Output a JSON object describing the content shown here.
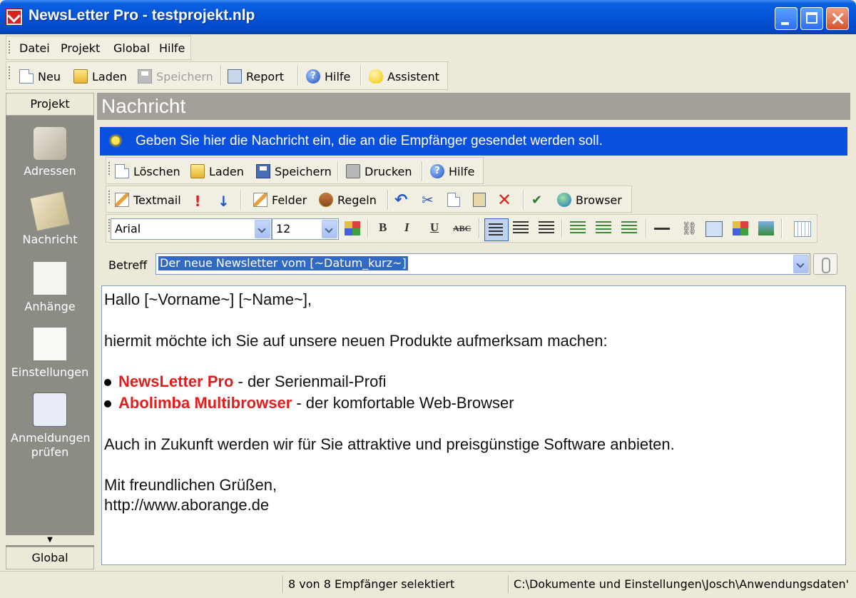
{
  "window": {
    "title": "NewsLetter Pro - testprojekt.nlp"
  },
  "menu": [
    "Datei",
    "Projekt",
    "Global",
    "Hilfe"
  ],
  "toolbar": {
    "new": "Neu",
    "load": "Laden",
    "save": "Speichern",
    "report": "Report",
    "help": "Hilfe",
    "assistant": "Assistent"
  },
  "sidebar": {
    "header": "Projekt",
    "items": [
      "Adressen",
      "Nachricht",
      "Anhänge",
      "Einstellungen",
      "Anmeldungen prüfen"
    ],
    "footer": "Global"
  },
  "main": {
    "title": "Nachricht",
    "info": "Geben Sie hier die Nachricht ein, die an die Empfänger gesendet werden soll."
  },
  "msg_toolbar": {
    "delete": "Löschen",
    "load": "Laden",
    "save": "Speichern",
    "print": "Drucken",
    "help": "Hilfe"
  },
  "edit_toolbar": {
    "textmail": "Textmail",
    "fields": "Felder",
    "rules": "Regeln",
    "browser": "Browser"
  },
  "format": {
    "font": "Arial",
    "size": "12",
    "bold": "B",
    "italic": "I",
    "underline": "U",
    "strike": "ABC"
  },
  "subject": {
    "label": "Betreff",
    "value": "Der neue Newsletter vom [~Datum_kurz~]"
  },
  "body": {
    "greeting": "Hallo [~Vorname~] [~Name~],",
    "intro": "hiermit möchte ich Sie auf unsere neuen Produkte aufmerksam machen:",
    "product1_name": "NewsLetter Pro",
    "product1_desc": " - der Serienmail-Profi",
    "product2_name": "Abolimba Multibrowser",
    "product2_desc": " - der komfortable Web-Browser",
    "future": "Auch in Zukunft werden wir für Sie attraktive und preisgünstige Software anbieten.",
    "closing": "Mit freundlichen Grüßen,",
    "url": " http://www.aborange.de"
  },
  "status": {
    "selection": "8 von 8 Empfänger selektiert",
    "path": "C:\\Dokumente und Einstellungen\\Josch\\Anwendungsdaten'"
  },
  "colors": {
    "titlebar": "#0554d8",
    "infobar": "#0a50e0",
    "product_red": "#e31c1c",
    "sidebar": "#8c8c84"
  }
}
